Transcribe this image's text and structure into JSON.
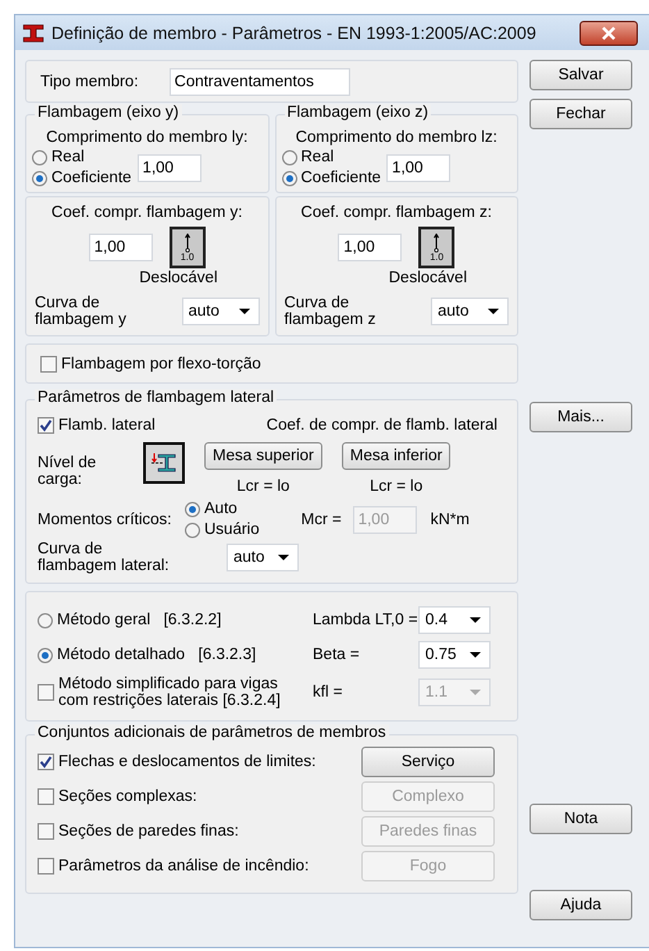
{
  "window": {
    "title": "Definição de membro - Parâmetros - EN 1993-1:2005/AC:2009"
  },
  "member_type": {
    "label": "Tipo membro:",
    "value": "Contraventamentos"
  },
  "buckling_axes": [
    {
      "title": "Flambagem (eixo y)",
      "length_label": "Comprimento do membro ly:",
      "options": [
        {
          "label": "Real",
          "selected": false
        },
        {
          "label": "Coeficiente",
          "selected": true
        }
      ],
      "coefficient": "1,00",
      "coef_label": "Coef. compr. flambagem y:",
      "coef_value": "1,00",
      "button_text": "1.0",
      "support_label": "Deslocável",
      "curve_label": "Curva de flambagem y",
      "curve_value": "auto"
    },
    {
      "title": "Flambagem (eixo z)",
      "length_label": "Comprimento do membro lz:",
      "options": [
        {
          "label": "Real",
          "selected": false
        },
        {
          "label": "Coeficiente",
          "selected": true
        }
      ],
      "coefficient": "1,00",
      "coef_label": "Coef. compr. flambagem z:",
      "coef_value": "1,00",
      "button_text": "1.0",
      "support_label": "Deslocável",
      "curve_label": "Curva de flambagem z",
      "curve_value": "auto"
    }
  ],
  "torsional": {
    "label": "Flambagem por flexo-torção",
    "checked": false
  },
  "lateral": {
    "title": "Parâmetros de flambagem lateral",
    "enabled": {
      "label": "Flamb. lateral",
      "checked": true
    },
    "coef_title": "Coef. de compr. de flamb. lateral",
    "load_label": "Nível de carga:",
    "flanges": [
      {
        "label": "Mesa superior",
        "formula": "Lcr =  lo"
      },
      {
        "label": "Mesa inferior",
        "formula": "Lcr =  lo"
      }
    ],
    "moments_label": "Momentos críticos:",
    "moment_options": [
      {
        "label": "Auto",
        "selected": true
      },
      {
        "label": "Usuário",
        "selected": false
      }
    ],
    "mcr_label": "Mcr =",
    "mcr_value": "1,00",
    "mcr_disabled": true,
    "mcr_unit": "kN*m",
    "curve_label": "Curva de flambagem lateral:",
    "curve_value": "auto"
  },
  "methods": [
    {
      "kind": "radio",
      "label": "Método geral",
      "ref": "[6.3.2.2]",
      "selected": false,
      "param_label": "Lambda LT,0 =",
      "param_value": "0.4",
      "disabled": false
    },
    {
      "kind": "radio",
      "label": "Método detalhado",
      "ref": "[6.3.2.3]",
      "selected": true,
      "param_label": "Beta =",
      "param_value": "0.75",
      "disabled": false
    },
    {
      "kind": "checkbox",
      "label": "Método simplificado para vigas com restrições laterais [6.3.2.4]",
      "checked": false,
      "param_label": "kfl =",
      "param_value": "1.1",
      "disabled": true
    }
  ],
  "additional": {
    "title": "Conjuntos adicionais de parâmetros de membros",
    "items": [
      {
        "label": "Flechas e deslocamentos de limites:",
        "checked": true,
        "button": "Serviço",
        "disabled": false
      },
      {
        "label": "Seções complexas:",
        "checked": false,
        "button": "Complexo",
        "disabled": true
      },
      {
        "label": "Seções de paredes finas:",
        "checked": false,
        "button": "Paredes finas",
        "disabled": true
      },
      {
        "label": "Parâmetros da análise de incêndio:",
        "checked": false,
        "button": "Fogo",
        "disabled": true
      }
    ]
  },
  "side_buttons": {
    "top": [
      "Salvar",
      "Fechar"
    ],
    "middle": [
      "Mais..."
    ],
    "lower": [
      "Nota"
    ],
    "bottom": [
      "Ajuda"
    ]
  }
}
